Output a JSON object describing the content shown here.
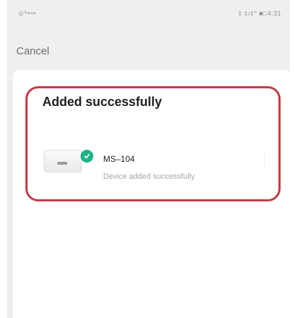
{
  "status_bar": {
    "left_text": "⊙º•ᵃ•",
    "right_text": "‡ ‡ı‡° ■□4:31"
  },
  "header": {
    "cancel_label": "Cancel"
  },
  "result": {
    "title": "Added successfully",
    "device": {
      "name": "MS–104",
      "status": "Device added successfully"
    }
  },
  "colors": {
    "highlight": "#c23a45",
    "success_badge": "#1cb387"
  },
  "icons": {
    "success": "check-circle-icon",
    "device": "device-icon"
  }
}
